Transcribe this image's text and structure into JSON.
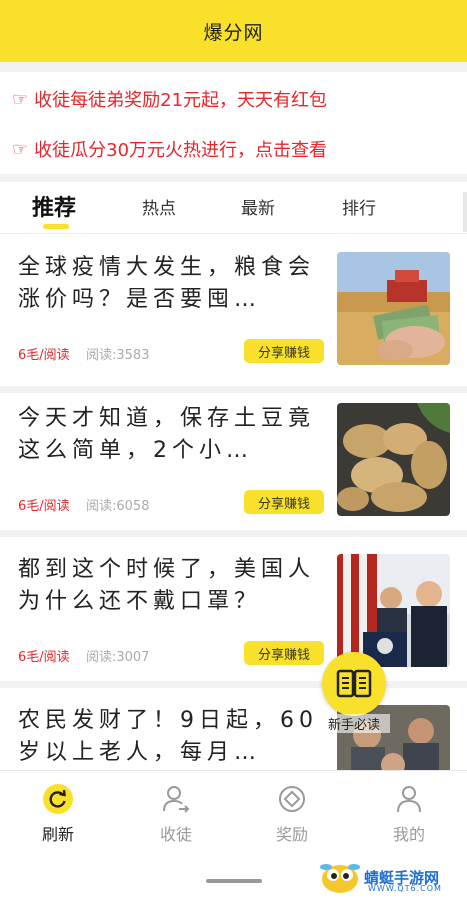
{
  "header": {
    "title": "爆分网"
  },
  "notices": [
    {
      "text": "收徒每徒弟奖励21元起，天天有红包"
    },
    {
      "text": "收徒瓜分30万元火热进行，点击查看"
    }
  ],
  "tabs": [
    {
      "label": "推荐",
      "active": true
    },
    {
      "label": "热点",
      "active": false
    },
    {
      "label": "最新",
      "active": false
    },
    {
      "label": "排行",
      "active": false
    }
  ],
  "articles": [
    {
      "title": "全球疫情大发生，粮食会涨价吗？是否要囤…",
      "price": "6毛/阅读",
      "reads": "阅读:3583",
      "share": "分享赚钱",
      "image": "wheat-harvest-money"
    },
    {
      "title": "今天才知道，保存土豆竟这么简单，2个小…",
      "price": "6毛/阅读",
      "reads": "阅读:6058",
      "share": "分享赚钱",
      "image": "potatoes"
    },
    {
      "title": "都到这个时候了，美国人为什么还不戴口罩？",
      "price": "6毛/阅读",
      "reads": "阅读:3007",
      "share": "分享赚钱",
      "image": "press-conference"
    },
    {
      "title": "农民发财了！9日起，60岁以上老人，每月…",
      "image": "elderly-people"
    }
  ],
  "float_badge": {
    "label": "新手必读",
    "icon": "book-icon"
  },
  "bottom_nav": [
    {
      "label": "刷新",
      "icon": "refresh-icon",
      "active": true
    },
    {
      "label": "收徒",
      "icon": "person-arrow-icon",
      "active": false
    },
    {
      "label": "奖励",
      "icon": "coin-icon",
      "active": false
    },
    {
      "label": "我的",
      "icon": "user-icon",
      "active": false
    }
  ],
  "watermark": {
    "text": "蜻蜓手游网",
    "url": "WWW.QT6.COM"
  },
  "colors": {
    "accent": "#f9e12b",
    "notice": "#e8262a",
    "muted": "#9a9a9a"
  }
}
